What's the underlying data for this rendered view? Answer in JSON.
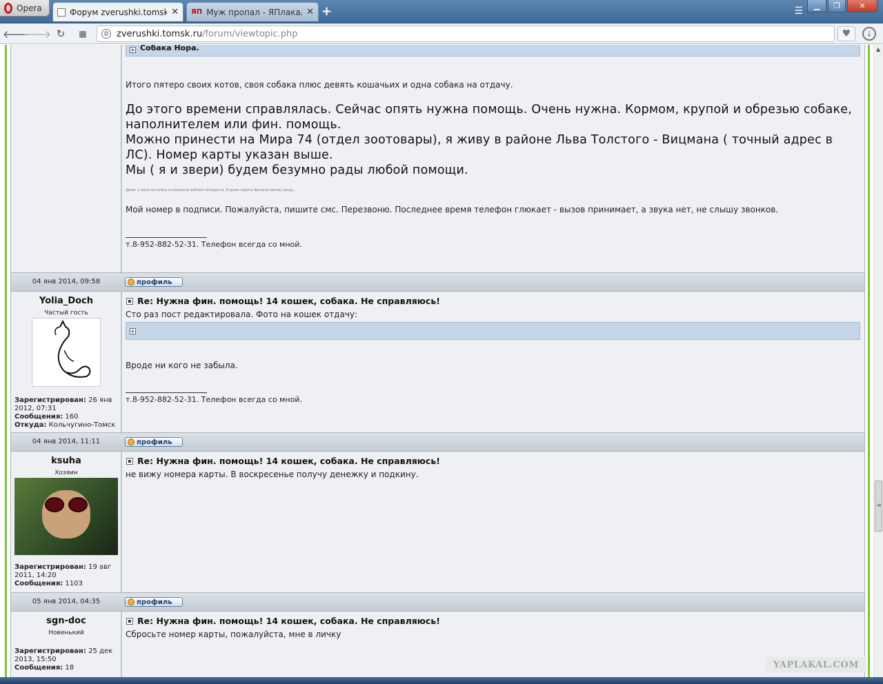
{
  "browser": {
    "menu_label": "Opera",
    "tabs": [
      {
        "title": "Форум zverushki.tomsk.ru"
      },
      {
        "title": "Муж пропал - ЯПлакаль"
      }
    ],
    "yap_favicon": "ЯП",
    "address": {
      "host": "zverushki.tomsk.ru",
      "path": "/forum/viewtopic.php"
    }
  },
  "posts": [
    {
      "spoiler_title": "Собака Нора.",
      "lines": [
        "Итого пятеро своих котов, своя собака плюс девять кошачьих и одна собака на отдачу."
      ],
      "big_lines": [
        "До этого времени справлялась. Сейчас опять нужна помощь. Очень нужна. Кормом, крупой и обрезью собаке,",
        "наполнителем или фин. помощь.",
        "Можно принести на Мира 74 (отдел зоотовары), я живу в районе Льва Толстого - Вицмана ( точный адрес в",
        "ЛС). Номер карты указан выше.",
        "Мы ( я и звери) будем безумно рады любой помощи."
      ],
      "tiny": "Денег у меня осталось в кошельке рублей четыреста. Я даже курить бросила месяц назад....",
      "after": "Мой номер в подписи. Пожалуйста, пишите смс. Перезвоню. Последнее время телефон глюкает - вызов принимает, а звука нет, не слышу звонков.",
      "signature": "т.8-952-882-52-31. Телефон всегда со мной.",
      "date": "04 янв 2014, 09:58",
      "profile_label": "профиль"
    },
    {
      "username": "Yolia_Doch",
      "rank": "Частый гость",
      "registered_label": "Зарегистрирован:",
      "registered": "26 янв 2012, 07:31",
      "posts_label": "Сообщения:",
      "posts": "160",
      "from_label": "Откуда:",
      "from": "Кольчугино-Томск",
      "title": "Re: Нужна фин. помощь! 14 кошек, собака. Не справляюсь!",
      "text1": "Сто раз пост редактировала. Фото на кошек отдачу:",
      "text2": "Вроде ни кого не забыла.",
      "signature": "т.8-952-882-52-31. Телефон всегда со мной.",
      "date": "04 янв 2014, 11:11",
      "profile_label": "профиль"
    },
    {
      "username": "ksuha",
      "rank": "Хозяин",
      "registered_label": "Зарегистрирован:",
      "registered": "19 авг 2011, 14:20",
      "posts_label": "Сообщения:",
      "posts": "1103",
      "title": "Re: Нужна фин. помощь! 14 кошек, собака. Не справляюсь!",
      "text1": "не вижу номера карты. В воскресенье получу денежку и подкину.",
      "date": "05 янв 2014, 04:35",
      "profile_label": "профиль"
    },
    {
      "username": "sgn-doc",
      "rank": "Новенький",
      "registered_label": "Зарегистрирован:",
      "registered": "25 дек 2013, 15:50",
      "posts_label": "Сообщения:",
      "posts": "18",
      "title": "Re: Нужна фин. помощь! 14 кошек, собака. Не справляюсь!",
      "text1": "Сбросьте номер карты, пожалуйста, мне в личку"
    }
  ],
  "watermark": "YAPLAKAL.COM"
}
